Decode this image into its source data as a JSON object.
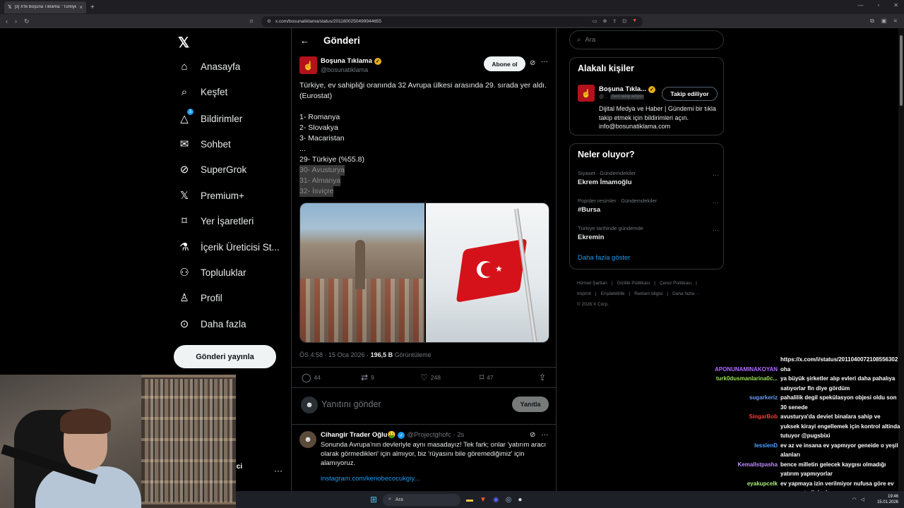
{
  "browser": {
    "tab_title": "[3] X'te Boşuna Tıklama: \"Türkiye...",
    "url": "x.com/bosunatiklama/status/2011800250499944655",
    "new_tab": "+"
  },
  "sidebar": {
    "logo": "𝕏",
    "items": [
      {
        "label": "Anasayfa",
        "icon": "home-icon",
        "glyph": "⌂"
      },
      {
        "label": "Keşfet",
        "icon": "search-icon",
        "glyph": "⌕"
      },
      {
        "label": "Bildirimler",
        "icon": "bell-icon",
        "glyph": "🔔",
        "badge": "3"
      },
      {
        "label": "Sohbet",
        "icon": "mail-icon",
        "glyph": "✉"
      },
      {
        "label": "SuperGrok",
        "icon": "grok-icon",
        "glyph": "⊘"
      },
      {
        "label": "Premium+",
        "icon": "x-icon",
        "glyph": "𝕏"
      },
      {
        "label": "Yer İşaretleri",
        "icon": "bookmark-icon",
        "glyph": "🔖"
      },
      {
        "label": "İçerik Üreticisi St...",
        "icon": "flask-icon",
        "glyph": "⚗"
      },
      {
        "label": "Topluluklar",
        "icon": "people-icon",
        "glyph": "👥"
      },
      {
        "label": "Profil",
        "icon": "person-icon",
        "glyph": "👤"
      },
      {
        "label": "Daha fazla",
        "icon": "more-circle-icon",
        "glyph": "⋯"
      }
    ],
    "post_button": "Gönderi yayınla",
    "account_partial": "ici"
  },
  "main": {
    "header_title": "Gönderi",
    "tweet": {
      "author_name": "Boşuna Tıklama",
      "author_handle": "@bosunatiklama",
      "subscribe": "Abone ol",
      "lines": [
        "Türkiye, ev sahipliği oranında 32 Avrupa ülkesi arasında 29. sırada yer aldı. (Eurostat)",
        "",
        "1- Romanya",
        "2- Slovakya",
        "3- Macaristan",
        "...",
        "29- Türkiye (%55.8)"
      ],
      "highlighted_lines": [
        "30- Avusturya",
        "31- Almanya",
        "32- İsviçre"
      ],
      "time": "ÖS 4:58 · 15 Oca 2026 · ",
      "views": "196,5 B",
      "views_label": " Görüntüleme",
      "stats": {
        "replies": "44",
        "reposts": "9",
        "likes": "248",
        "bookmarks": "47"
      }
    },
    "reply_placeholder": "Yanıtını gönder",
    "reply_button": "Yanıtla",
    "reply": {
      "name": "Cihangir Trader Oğlu🤑",
      "handle": "@Projectghofc · 2s",
      "text": "Sonunda Avrupa'nın devleriyle aynı masadayız! Tek fark; onlar 'yatırım aracı olarak görmedikleri' için almıyor, biz 'rüyasını bile göremediğimiz' için alamıyoruz.",
      "link": "instagram.com/kenobecocukgiy..."
    }
  },
  "right": {
    "search_placeholder": "Ara",
    "related_title": "Alakalı kişiler",
    "related": {
      "name": "Boşuna Tıkla...",
      "handle": "@...",
      "follows_you": "Seni takip ediyor",
      "button": "Takip ediliyor",
      "bio": "Dijital Medya ve Haber | Gündemi bir tıkla takip etmek için bildirimleri açın. info@bosunatiklama.com"
    },
    "trends_title": "Neler oluyor?",
    "trends": [
      {
        "category": "Siyaset · Gündemdekiler",
        "name": "Ekrem İmamoğlu"
      },
      {
        "category": "Popüler resimler · Gündemdekiler",
        "name": "#Bursa"
      },
      {
        "category": "Türkiye tarihinde gündemde",
        "name": "Ekremin"
      }
    ],
    "show_more": "Daha fazla göster",
    "footer": [
      "Hizmet Şartları",
      "|",
      "Gizlilik Politikası",
      "|",
      "Çerez Politikası",
      "|",
      "Imprint",
      "|",
      "Erişilebilirlik",
      "|",
      "Reklam bilgisi",
      "|",
      "Daha fazla ···",
      "© 2026 X Corp."
    ]
  },
  "chat": [
    {
      "user": "",
      "color": "#ffffff",
      "msg": "https://x.com/i/status/2011040072108556302"
    },
    {
      "user": "APONUNAMINAKOYAN",
      "color": "#b36cff",
      "msg": "oha"
    },
    {
      "user": "turk0dusmanlarina0c...",
      "color": "#9be05a",
      "msg": "ya büyük şirketler alıp evleri daha pahalıya satıyorlar fln diye gördüm"
    },
    {
      "user": "sugarkeriz",
      "color": "#6e9cff",
      "msg": "pahalilik degil spekülasyon objesi oldu son 30 senede"
    },
    {
      "user": "SingarBob",
      "color": "#ff3b3b",
      "msg": "avusturya'da deviet binalara sahip ve yuksek kirayi engellemek için kontrol altinda tutuyor @pugsbixi"
    },
    {
      "user": "IessienD",
      "color": "#4aa3ff",
      "msg": "ev az ve insana ev yapmıyor geneide o yeşil alanları"
    },
    {
      "user": "Kemallstpasha",
      "color": "#c08cff",
      "msg": "bence milletin gelecek kaygısı olmadığı yatırım yapmıyorlar"
    },
    {
      "user": "eyakupcelk",
      "color": "#a6f07a",
      "msg": "ev yapmaya izin verilmiyor nufusa göre ev sayısı yeterli deel"
    }
  ],
  "taskbar": {
    "search": "Ara",
    "time": "19:46",
    "date": "15.01.2026"
  },
  "colors": {
    "accent": "#1d9bf0",
    "background": "#000000",
    "brand_red": "#b3121b"
  }
}
